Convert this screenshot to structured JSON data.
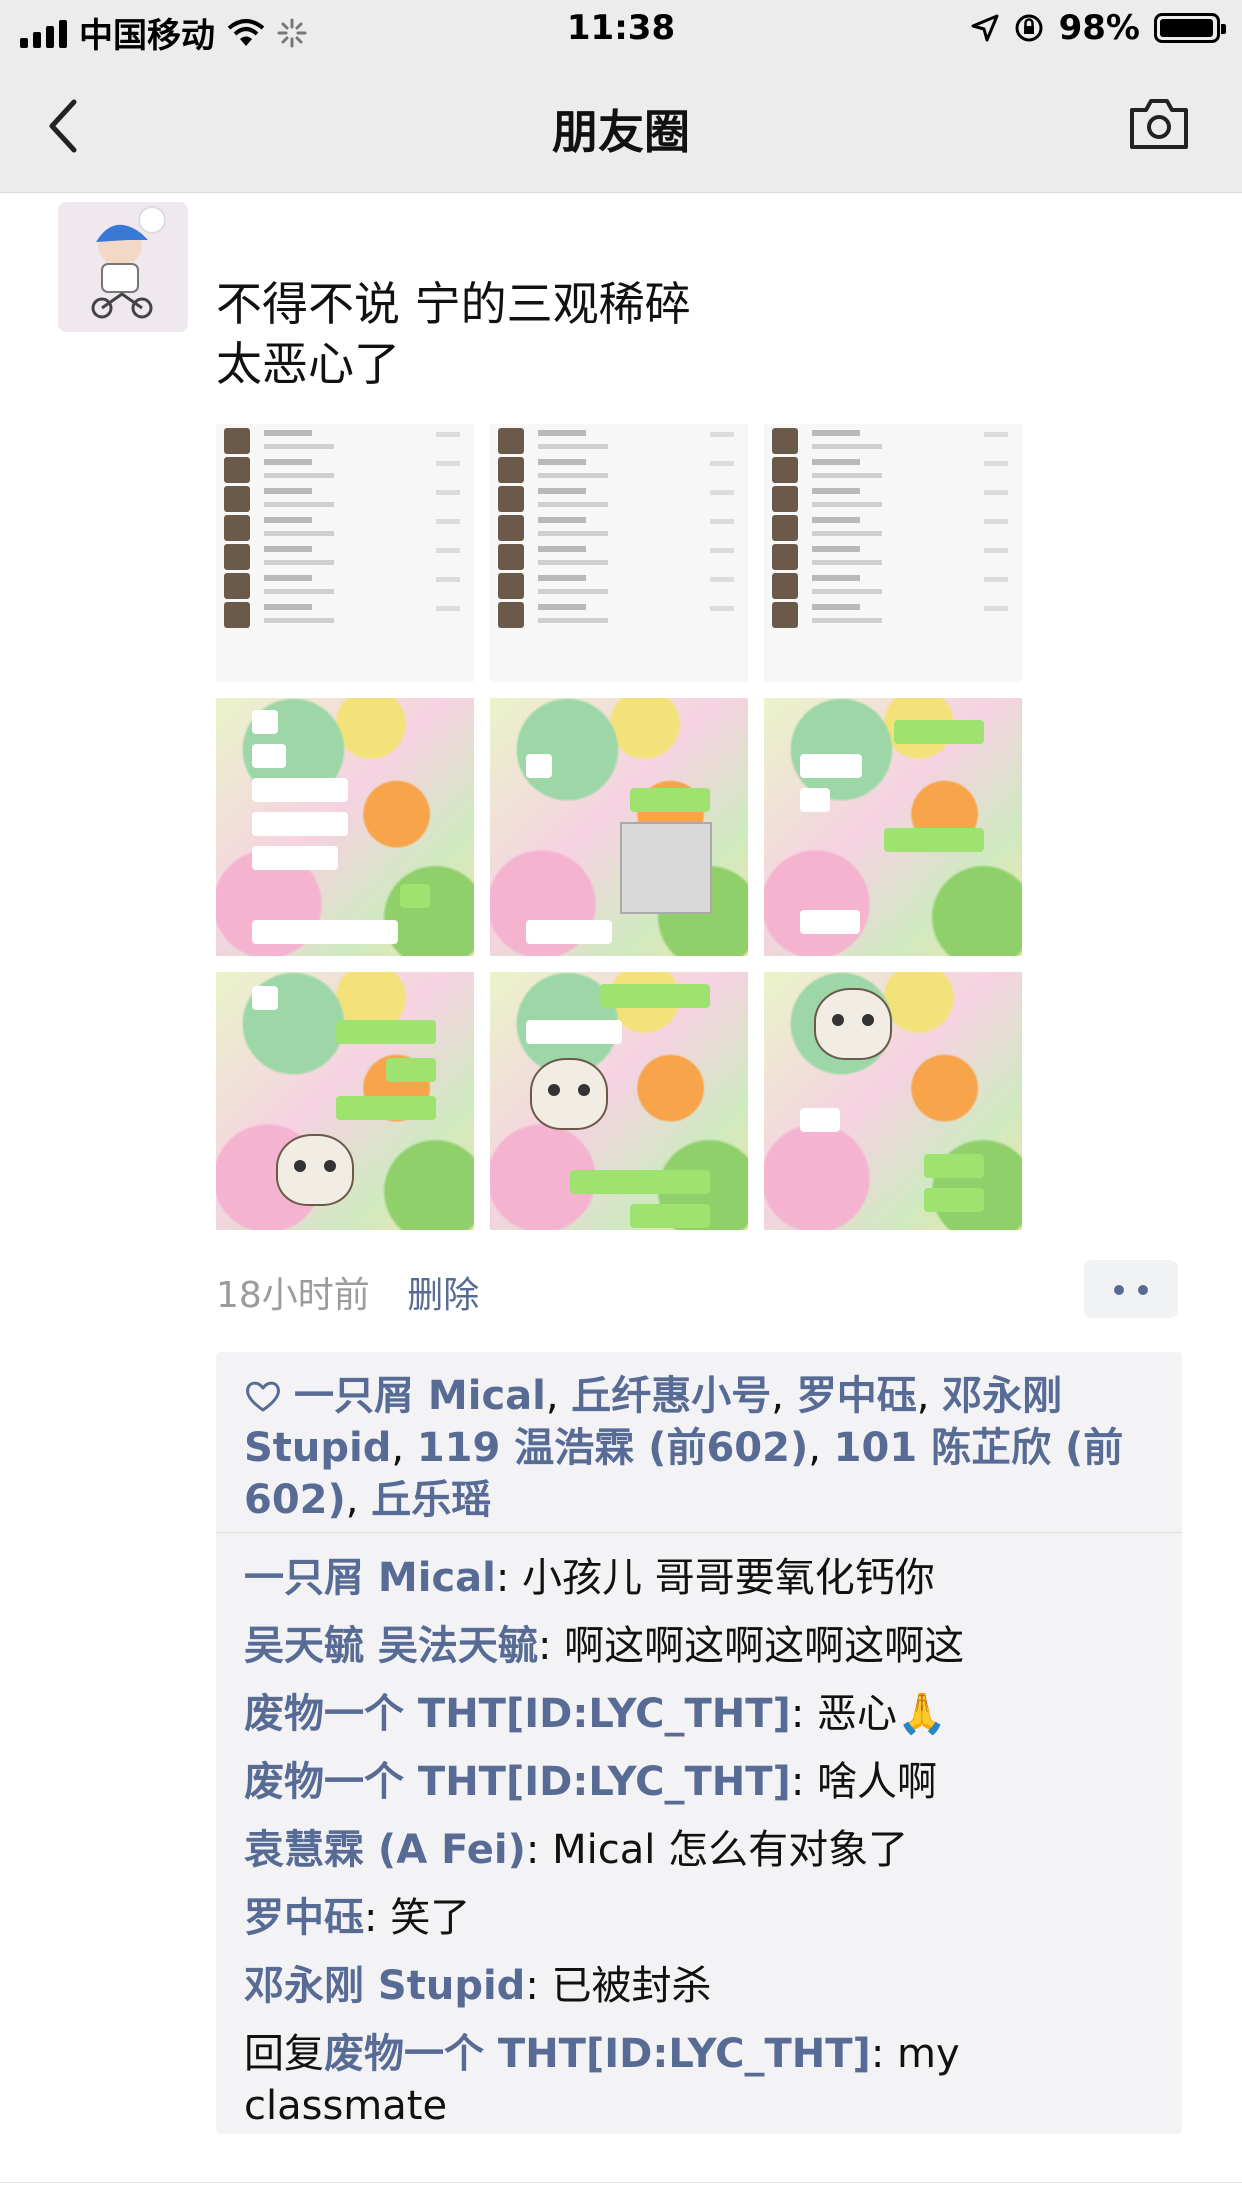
{
  "status_bar": {
    "carrier": "中国移动",
    "time": "11:38",
    "battery": "98%",
    "battery_level": 0.98,
    "icons": [
      "signal-icon",
      "wifi-icon",
      "loading-icon",
      "location-arrow-icon",
      "rotation-lock-icon",
      "battery-icon"
    ]
  },
  "nav": {
    "title": "朋友圈",
    "back_icon": "chevron-left-icon",
    "camera_icon": "camera-icon"
  },
  "post": {
    "text_line1": "不得不说 宁的三观稀碎",
    "text_line2": "太恶心了",
    "image_count": 9,
    "time_ago": "18小时前",
    "delete_label": "删除",
    "more_icon": "more-dots-icon"
  },
  "likes": {
    "icon": "heart-icon",
    "names": [
      "一只屑 Mical",
      "丘纤惠小号",
      "罗中砡",
      "邓永刚 Stupid",
      "119 温浩霖 (前602)",
      "101 陈芷欣 (前602)",
      "丘乐瑶"
    ],
    "separator": ", "
  },
  "comments": [
    {
      "prefix": "",
      "user": "一只屑 Mical",
      "text": ": 小孩儿 哥哥要氧化钙你"
    },
    {
      "prefix": "",
      "user": "吴天毓 吴法天毓",
      "text": ": 啊这啊这啊这啊这啊这"
    },
    {
      "prefix": "",
      "user": "废物一个 THT[ID:LYC_THT]",
      "text": ": 恶心🙏"
    },
    {
      "prefix": "",
      "user": "废物一个 THT[ID:LYC_THT]",
      "text": ": 啥人啊"
    },
    {
      "prefix": "",
      "user": "袁慧霖 (A Fei)",
      "text": ": Mical 怎么有对象了"
    },
    {
      "prefix": "",
      "user": "罗中砡",
      "text": ": 笑了"
    },
    {
      "prefix": "",
      "user": "邓永刚 Stupid",
      "text": ": 已被封杀"
    },
    {
      "prefix": "回复",
      "user": "废物一个 THT[ID:LYC_THT]",
      "text": ": my classmate"
    }
  ]
}
